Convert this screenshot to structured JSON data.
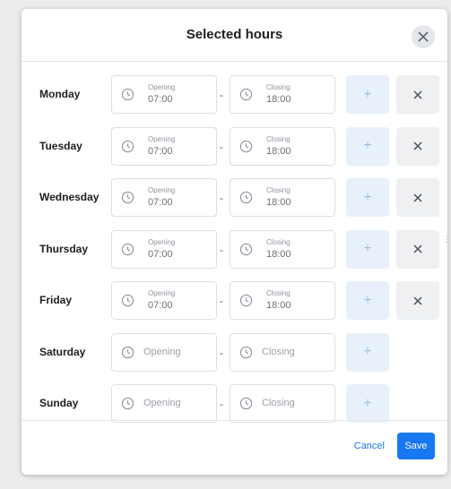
{
  "dialog": {
    "title": "Selected hours",
    "cancel_label": "Cancel",
    "save_label": "Save"
  },
  "days": [
    {
      "name": "Monday",
      "opening_label": "Opening",
      "opening_time": "07:00",
      "closing_label": "Closing",
      "closing_time": "18:00",
      "has_delete": true
    },
    {
      "name": "Tuesday",
      "opening_label": "Opening",
      "opening_time": "07:00",
      "closing_label": "Closing",
      "closing_time": "18:00",
      "has_delete": true
    },
    {
      "name": "Wednesday",
      "opening_label": "Opening",
      "opening_time": "07:00",
      "closing_label": "Closing",
      "closing_time": "18:00",
      "has_delete": true
    },
    {
      "name": "Thursday",
      "opening_label": "Opening",
      "opening_time": "07:00",
      "closing_label": "Closing",
      "closing_time": "18:00",
      "has_delete": true
    },
    {
      "name": "Friday",
      "opening_label": "Opening",
      "opening_time": "07:00",
      "closing_label": "Closing",
      "closing_time": "18:00",
      "has_delete": true
    },
    {
      "name": "Saturday",
      "opening_placeholder": "Opening",
      "closing_placeholder": "Closing",
      "has_delete": false
    },
    {
      "name": "Sunday",
      "opening_placeholder": "Opening",
      "closing_placeholder": "Closing",
      "has_delete": false
    }
  ],
  "separator": "-",
  "add_symbol": "+",
  "colors": {
    "accent": "#1877f2",
    "add_button_bg": "#e8f1fb",
    "delete_button_bg": "#eef0f2"
  },
  "icons": {
    "close": "close-icon",
    "clock": "clock-icon",
    "add": "plus-icon",
    "delete": "close-icon"
  }
}
